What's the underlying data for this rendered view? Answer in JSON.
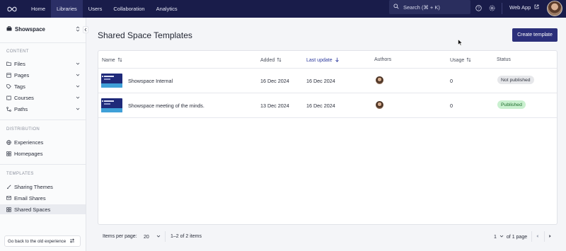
{
  "topbar": {
    "logo": "infinity-logo",
    "nav": [
      {
        "label": "Home",
        "active": false
      },
      {
        "label": "Libraries",
        "active": true
      },
      {
        "label": "Users",
        "active": false
      },
      {
        "label": "Collaboration",
        "active": false
      },
      {
        "label": "Analytics",
        "active": false
      }
    ],
    "search_label": "Search (⌘ + K)",
    "web_app_label": "Web App"
  },
  "sidebar": {
    "space_name": "Showspace",
    "sections": {
      "content": "CONTENT",
      "distribution": "DISTRIBUTION",
      "templates": "TEMPLATES"
    },
    "content_items": [
      {
        "label": "Files",
        "icon": "folder-icon"
      },
      {
        "label": "Pages",
        "icon": "page-icon"
      },
      {
        "label": "Tags",
        "icon": "tag-icon"
      },
      {
        "label": "Courses",
        "icon": "book-icon"
      },
      {
        "label": "Paths",
        "icon": "path-icon"
      }
    ],
    "distribution_items": [
      {
        "label": "Experiences",
        "icon": "globe-icon"
      },
      {
        "label": "Homepages",
        "icon": "grid-icon"
      }
    ],
    "template_items": [
      {
        "label": "Sharing Themes",
        "icon": "brush-icon"
      },
      {
        "label": "Email Shares",
        "icon": "mail-icon"
      },
      {
        "label": "Shared Spaces",
        "icon": "grid-icon",
        "active": true
      }
    ],
    "old_experience_label": "Go back to the old experience"
  },
  "main": {
    "title": "Shared Space Templates",
    "create_button": "Create template",
    "columns": {
      "name": "Name",
      "added": "Added",
      "last_update": "Last update",
      "authors": "Authors",
      "usage": "Usage",
      "status": "Status"
    },
    "rows": [
      {
        "name": "Showspace Internal",
        "added": "16 Dec 2024",
        "last_update": "16 Dec 2024",
        "usage": "0",
        "status": "Not published",
        "status_color": "#e6e7ea"
      },
      {
        "name": "Showspace meeting of the minds.",
        "added": "13 Dec 2024",
        "last_update": "16 Dec 2024",
        "usage": "0",
        "status": "Published",
        "status_color": "#c9f0cf"
      }
    ],
    "pagination": {
      "items_per_page_label": "Items per page:",
      "items_per_page_value": "20",
      "range_text": "1–2 of 2 items",
      "current_page": "1",
      "of_pages": "of 1 page"
    }
  },
  "colors": {
    "topbar_bg": "#191c4a",
    "primary_button": "#2b2f7a",
    "sort_active": "#2d3a9e"
  }
}
